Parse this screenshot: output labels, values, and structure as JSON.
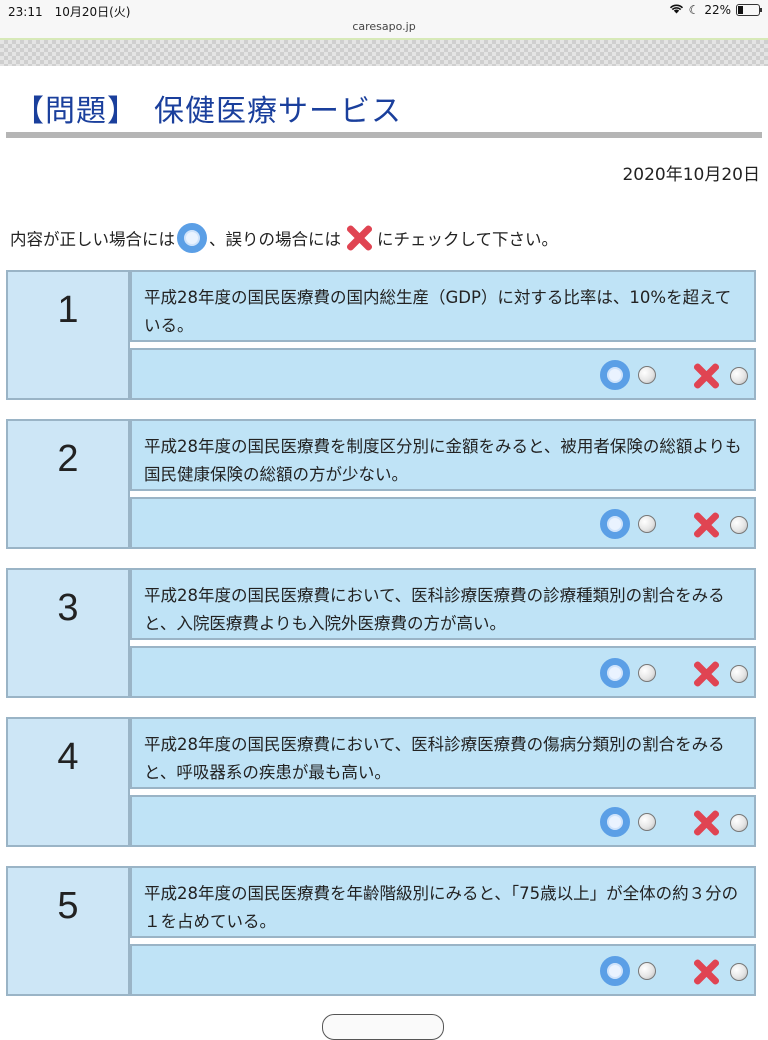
{
  "status": {
    "time": "23:11　10月20日(火)",
    "battery": "22%"
  },
  "browser": {
    "url": "caresapo.jp"
  },
  "page": {
    "title": "【問題】　保健医療サービス",
    "date": "2020年10月20日",
    "instruction": {
      "part1": "内容が正しい場合には",
      "part2": "、誤りの場合には",
      "part3": "にチェックして下さい。"
    }
  },
  "questions": [
    {
      "number": "1",
      "text": "平成28年度の国民医療費の国内総生産（GDP）に対する比率は、10%を超えている。"
    },
    {
      "number": "2",
      "text": "平成28年度の国民医療費を制度区分別に金額をみると、被用者保険の総額よりも国民健康保険の総額の方が少ない。"
    },
    {
      "number": "3",
      "text": "平成28年度の国民医療費において、医科診療医療費の診療種類別の割合をみると、入院医療費よりも入院外医療費の方が高い。"
    },
    {
      "number": "4",
      "text": "平成28年度の国民医療費において、医科診療医療費の傷病分類別の割合をみると、呼吸器系の疾患が最も高い。"
    },
    {
      "number": "5",
      "text": "平成28年度の国民医療費を年齢階級別にみると、「75歳以上」が全体の約３分の１を占めている。"
    }
  ],
  "colors": {
    "title": "#1a3f9c",
    "cell_bg": "#bfe3f6",
    "number_bg": "#cde6f6",
    "ring": "#5b9fe6",
    "cross": "#e04452"
  }
}
